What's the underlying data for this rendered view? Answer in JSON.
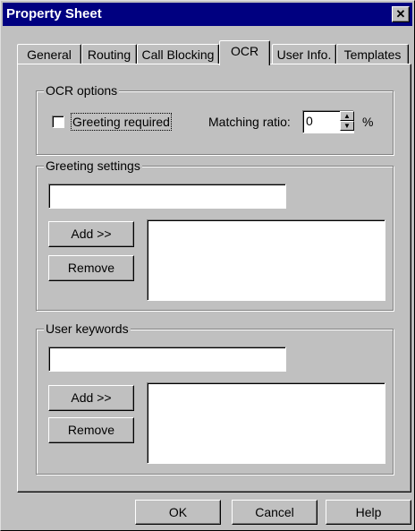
{
  "window": {
    "title": "Property Sheet",
    "close_glyph": "✕"
  },
  "tabs": [
    "General",
    "Routing",
    "Call Blocking",
    "OCR",
    "User Info.",
    "Templates"
  ],
  "ocr_options": {
    "group_label": "OCR options",
    "greeting_required_label": "Greeting required",
    "greeting_required_checked": false,
    "matching_ratio_label": "Matching ratio:",
    "matching_ratio_value": "0",
    "percent_symbol": "%"
  },
  "greeting_settings": {
    "group_label": "Greeting settings",
    "input_value": "",
    "add_label": "Add >>",
    "remove_label": "Remove",
    "items": []
  },
  "user_keywords": {
    "group_label": "User keywords",
    "input_value": "",
    "add_label": "Add >>",
    "remove_label": "Remove",
    "items": []
  },
  "footer": {
    "ok_label": "OK",
    "cancel_label": "Cancel",
    "help_label": "Help"
  }
}
